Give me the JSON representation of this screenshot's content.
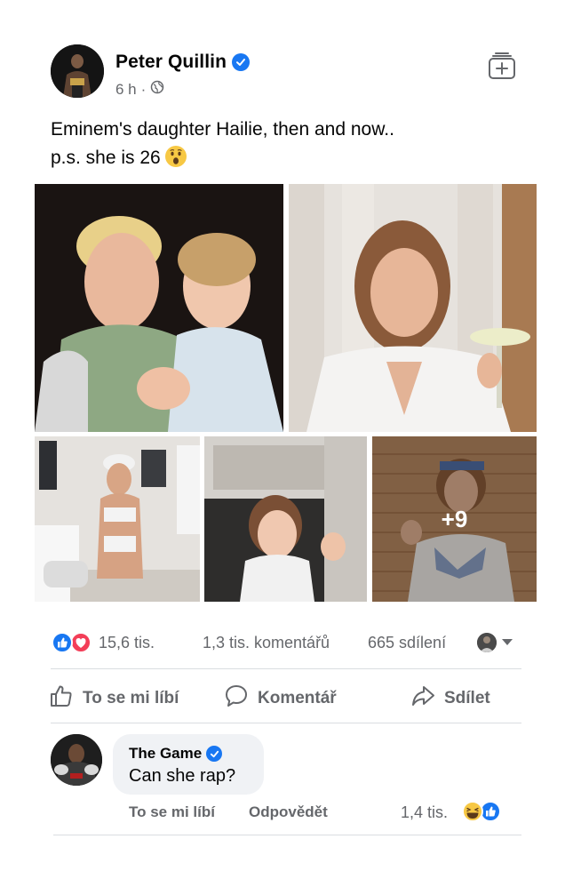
{
  "post": {
    "author": "Peter Quillin",
    "time": "6 h",
    "meta_separator": "·",
    "text": "Eminem's daughter Hailie, then and now..\np.s. she is 26"
  },
  "photos": {
    "more_count": "+9"
  },
  "stats": {
    "reactions": "15,6 tis.",
    "comments": "1,3 tis. komentářů",
    "shares": "665 sdílení"
  },
  "actions": {
    "like": "To se mi líbí",
    "comment": "Komentář",
    "share": "Sdílet"
  },
  "comment": {
    "author": "The Game",
    "text": "Can she rap?",
    "like": "To se mi líbí",
    "reply": "Odpovědět",
    "reaction_count": "1,4 tis."
  },
  "colors": {
    "brand_blue": "#1877f2",
    "love_red": "#f33e58",
    "text_secondary": "#65676b",
    "bubble_bg": "#f0f2f5",
    "divider": "#dadde1"
  },
  "icons": [
    "verified-badge-icon",
    "globe-icon",
    "save-icon",
    "like-reaction-icon",
    "love-reaction-icon",
    "haha-reaction-icon",
    "wow-emoji-icon",
    "thumbs-up-icon",
    "comment-icon",
    "share-icon",
    "chevron-down-icon"
  ]
}
